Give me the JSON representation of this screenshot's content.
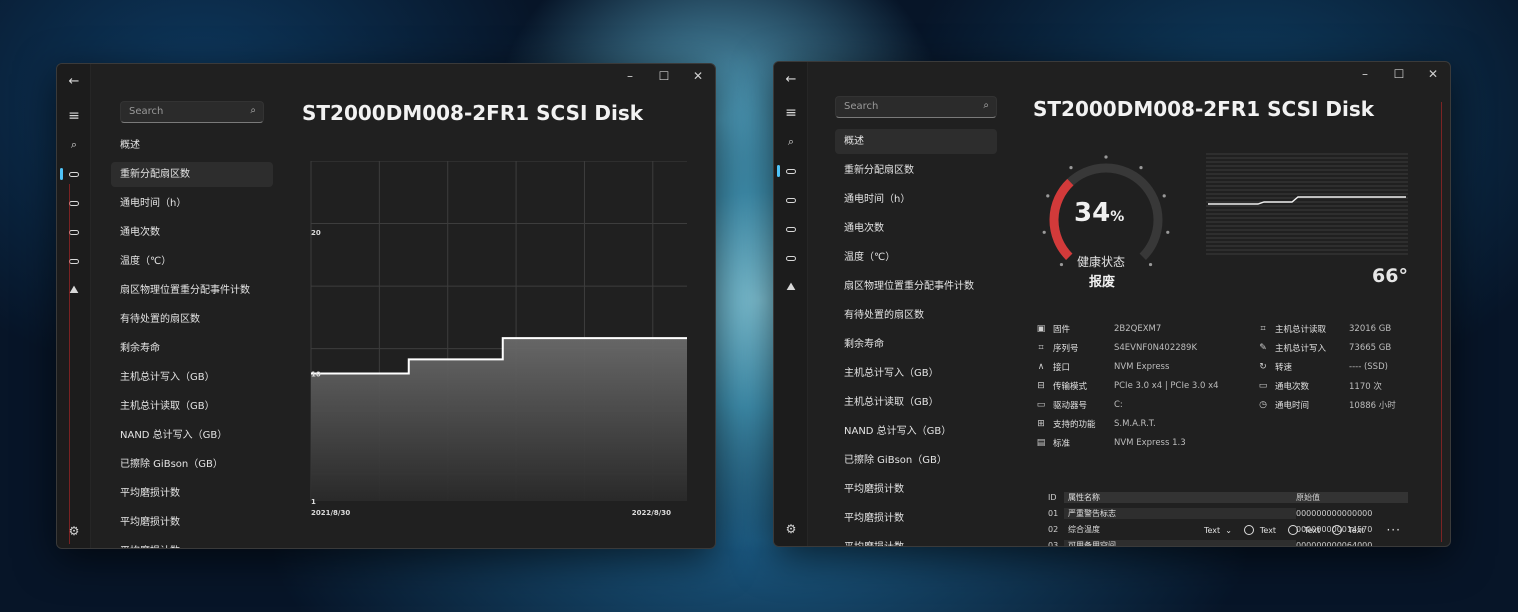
{
  "windows": {
    "left": {
      "title": "ST2000DM008-2FR1 SCSI Disk",
      "search_placeholder": "Search",
      "nav_items": [
        "概述",
        "重新分配扇区数",
        "通电时间（h）",
        "通电次数",
        "温度（℃）",
        "扇区物理位置重分配事件计数",
        "有待处置的扇区数",
        "剩余寿命",
        "主机总计写入（GB）",
        "主机总计读取（GB）",
        "NAND 总计写入（GB）",
        "已擦除 GiBson（GB）",
        "平均磨损计数",
        "平均磨损计数",
        "平均磨损计数"
      ],
      "selected_nav_index": 1
    },
    "right": {
      "title": "ST2000DM008-2FR1 SCSI Disk",
      "search_placeholder": "Search",
      "nav_items": [
        "概述",
        "重新分配扇区数",
        "通电时间（h）",
        "通电次数",
        "温度（℃）",
        "扇区物理位置重分配事件计数",
        "有待处置的扇区数",
        "剩余寿命",
        "主机总计写入（GB）",
        "主机总计读取（GB）",
        "NAND 总计写入（GB）",
        "已擦除 GiBson（GB）",
        "平均磨损计数",
        "平均磨损计数",
        "平均磨损计数"
      ],
      "selected_nav_index": 0,
      "health": {
        "percent": 34,
        "percent_text": "34",
        "percent_sign": "%",
        "status_label": "健康状态",
        "status_value": "报废",
        "accent_color": "#d23a3a"
      },
      "temperature": "66°",
      "info_left": [
        {
          "icon": "chip-icon",
          "glyph": "▣",
          "label": "固件",
          "value": "2B2QEXM7"
        },
        {
          "icon": "serial-icon",
          "glyph": "⌗",
          "label": "序列号",
          "value": "S4EVNF0N402289K"
        },
        {
          "icon": "interface-icon",
          "glyph": "∧",
          "label": "接口",
          "value": "NVM Express"
        },
        {
          "icon": "bus-icon",
          "glyph": "⊟",
          "label": "传输模式",
          "value": "PCIe 3.0 x4 | PCIe 3.0 x4"
        },
        {
          "icon": "drive-icon",
          "glyph": "▭",
          "label": "驱动器号",
          "value": "C:"
        },
        {
          "icon": "features-icon",
          "glyph": "⊞",
          "label": "支持的功能",
          "value": "S.M.A.R.T."
        },
        {
          "icon": "standard-icon",
          "glyph": "▤",
          "label": "标准",
          "value": "NVM Express 1.3"
        }
      ],
      "info_right": [
        {
          "icon": "read-icon",
          "glyph": "⌗",
          "label": "主机总计读取",
          "value": "32016 GB"
        },
        {
          "icon": "write-icon",
          "glyph": "✎",
          "label": "主机总计写入",
          "value": "73665 GB"
        },
        {
          "icon": "speed-icon",
          "glyph": "↻",
          "label": "转速",
          "value": "---- (SSD)"
        },
        {
          "icon": "power-count-icon",
          "glyph": "▭",
          "label": "通电次数",
          "value": "1170 次"
        },
        {
          "icon": "clock-icon",
          "glyph": "◷",
          "label": "通电时间",
          "value": "10886 小时"
        }
      ],
      "smart_table": {
        "headers": {
          "id": "ID",
          "name": "属性名称",
          "raw": "原始值"
        },
        "rows": [
          {
            "id": "01",
            "name": "严重警告标志",
            "raw": "000000000000000"
          },
          {
            "id": "02",
            "name": "综合温度",
            "raw": "000000000014570"
          },
          {
            "id": "03",
            "name": "可用备用空间",
            "raw": "000000000064000"
          }
        ]
      },
      "command_bar": {
        "dropdown_label": "Text",
        "radio_labels": [
          "Text",
          "Text",
          "Text"
        ],
        "more_label": "···"
      }
    }
  },
  "chart_data": {
    "type": "line",
    "title": "",
    "xlabel": "",
    "ylabel": "",
    "x_tick_labels": [
      "2021/8/30",
      "2022/8/30"
    ],
    "y_tick_labels": [
      "1",
      "10",
      "20"
    ],
    "ylim": [
      1,
      25
    ],
    "grid": true,
    "series": [
      {
        "values": [
          {
            "x": 0.0,
            "y": 10
          },
          {
            "x": 0.26,
            "y": 10
          },
          {
            "x": 0.26,
            "y": 11
          },
          {
            "x": 0.51,
            "y": 11
          },
          {
            "x": 0.51,
            "y": 12.5
          },
          {
            "x": 1.0,
            "y": 12.5
          }
        ]
      }
    ]
  }
}
